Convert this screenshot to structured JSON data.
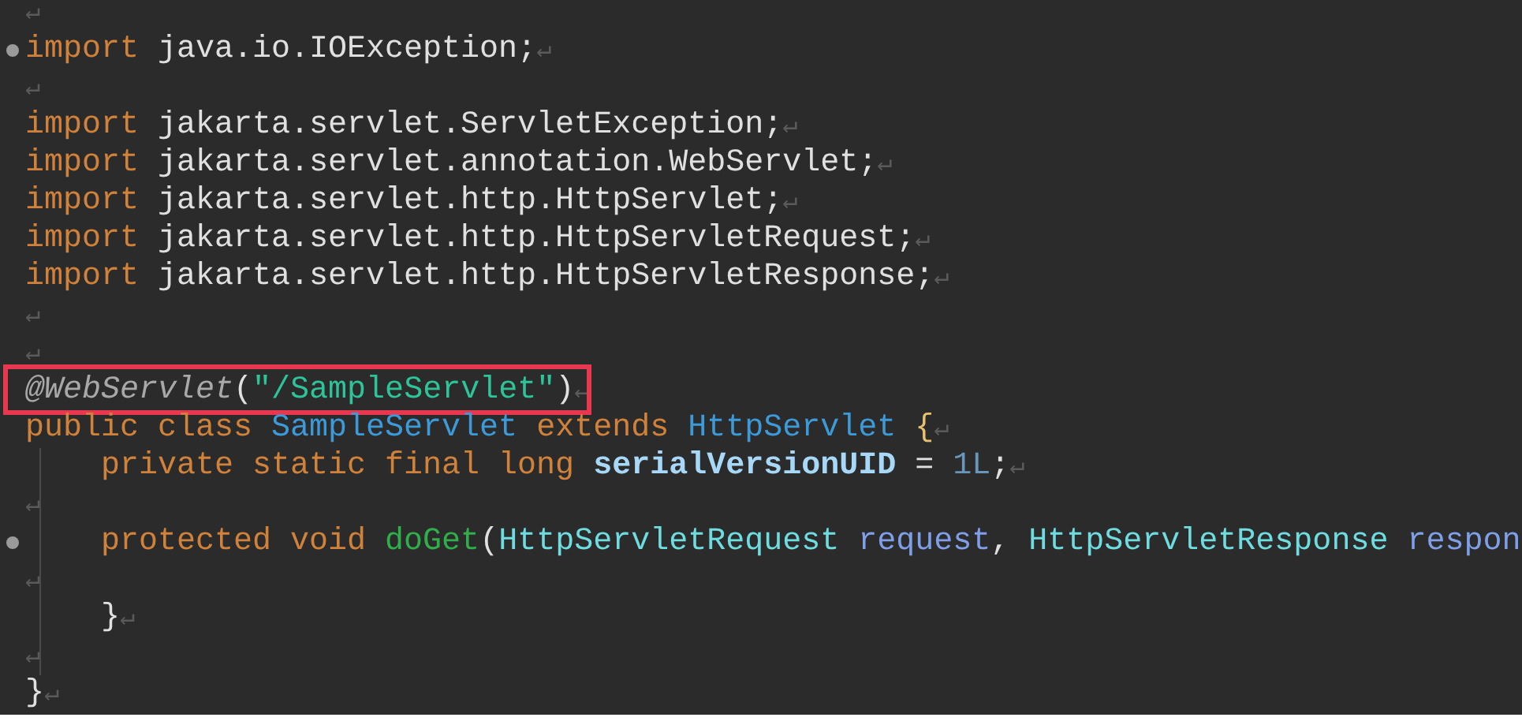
{
  "editor": {
    "lines": [
      {
        "eol": "↵"
      },
      {
        "fold_marker": true,
        "tokens": [
          {
            "kind": "keyword",
            "text": "import"
          },
          {
            "kind": "plain",
            "text": " java.io.IOException;"
          }
        ],
        "eol": "↵"
      },
      {
        "eol": "↵"
      },
      {
        "tokens": [
          {
            "kind": "keyword",
            "text": "import"
          },
          {
            "kind": "plain",
            "text": " jakarta.servlet.ServletException;"
          }
        ],
        "eol": "↵"
      },
      {
        "tokens": [
          {
            "kind": "keyword",
            "text": "import"
          },
          {
            "kind": "plain",
            "text": " jakarta.servlet.annotation.WebServlet;"
          }
        ],
        "eol": "↵"
      },
      {
        "tokens": [
          {
            "kind": "keyword",
            "text": "import"
          },
          {
            "kind": "plain",
            "text": " jakarta.servlet.http.HttpServlet;"
          }
        ],
        "eol": "↵"
      },
      {
        "tokens": [
          {
            "kind": "keyword",
            "text": "import"
          },
          {
            "kind": "plain",
            "text": " jakarta.servlet.http.HttpServletRequest;"
          }
        ],
        "eol": "↵"
      },
      {
        "tokens": [
          {
            "kind": "keyword",
            "text": "import"
          },
          {
            "kind": "plain",
            "text": " jakarta.servlet.http.HttpServletResponse;"
          }
        ],
        "eol": "↵"
      },
      {
        "eol": "↵"
      },
      {
        "eol": "↵"
      },
      {
        "highlighted": true,
        "tokens": [
          {
            "kind": "annotation",
            "text": "@WebServlet"
          },
          {
            "kind": "plain",
            "text": "("
          },
          {
            "kind": "string",
            "text": "\"/SampleServlet\""
          },
          {
            "kind": "plain",
            "text": ")"
          }
        ],
        "eol": "↵"
      },
      {
        "tokens": [
          {
            "kind": "keyword",
            "text": "public class "
          },
          {
            "kind": "type",
            "text": "SampleServlet"
          },
          {
            "kind": "keyword",
            "text": " extends "
          },
          {
            "kind": "type",
            "text": "HttpServlet"
          },
          {
            "kind": "brace",
            "text": " {"
          }
        ],
        "eol": "↵"
      },
      {
        "indent_guide": true,
        "tokens": [
          {
            "kind": "keyword",
            "text": "    private static final long "
          },
          {
            "kind": "field",
            "text": "serialVersionUID"
          },
          {
            "kind": "plain",
            "text": " = "
          },
          {
            "kind": "number",
            "text": "1L"
          },
          {
            "kind": "plain",
            "text": ";"
          }
        ],
        "eol": "↵"
      },
      {
        "indent_guide": true,
        "eol": "↵"
      },
      {
        "fold_marker": true,
        "indent_guide": true,
        "tokens": [
          {
            "kind": "keyword",
            "text": "    protected void "
          },
          {
            "kind": "method",
            "text": "doGet"
          },
          {
            "kind": "plain",
            "text": "("
          },
          {
            "kind": "class",
            "text": "HttpServletRequest"
          },
          {
            "kind": "param",
            "text": " request"
          },
          {
            "kind": "plain",
            "text": ", "
          },
          {
            "kind": "class",
            "text": "HttpServletResponse"
          },
          {
            "kind": "param",
            "text": " respon"
          }
        ]
      },
      {
        "indent_guide": true,
        "eol": "↵"
      },
      {
        "indent_guide": true,
        "tokens": [
          {
            "kind": "plain",
            "text": "    }"
          }
        ],
        "eol": "↵"
      },
      {
        "indent_guide": true,
        "eol": "↵"
      },
      {
        "tokens": [
          {
            "kind": "plain",
            "text": "}"
          }
        ],
        "eol": "↵"
      }
    ]
  }
}
